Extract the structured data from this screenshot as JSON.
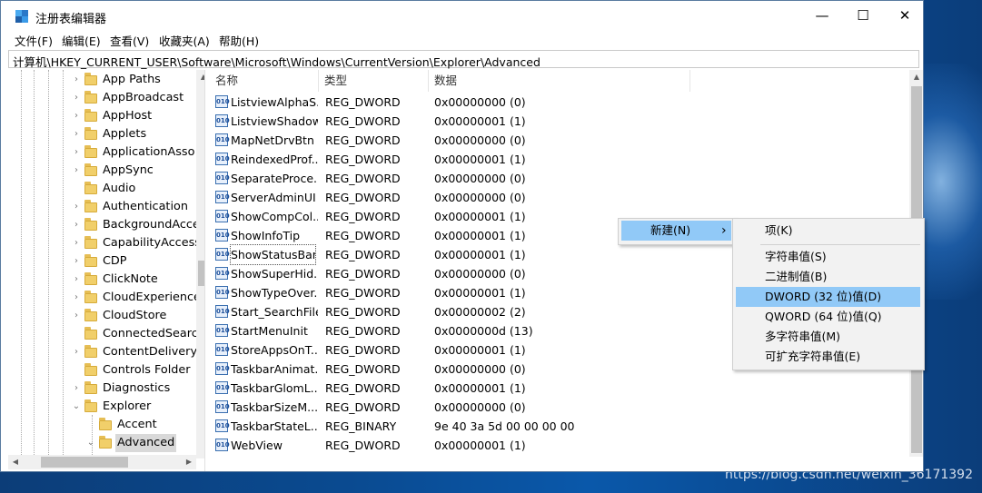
{
  "window": {
    "title": "注册表编辑器",
    "controls": {
      "minimize": "—",
      "maximize": "☐",
      "close": "✕"
    }
  },
  "menu": [
    "文件(F)",
    "编辑(E)",
    "查看(V)",
    "收藏夹(A)",
    "帮助(H)"
  ],
  "address": "计算机\\HKEY_CURRENT_USER\\Software\\Microsoft\\Windows\\CurrentVersion\\Explorer\\Advanced",
  "tree": [
    {
      "label": "App Paths",
      "expander": "›"
    },
    {
      "label": "AppBroadcast",
      "expander": "›"
    },
    {
      "label": "AppHost",
      "expander": "›"
    },
    {
      "label": "Applets",
      "expander": "›"
    },
    {
      "label": "ApplicationAsso",
      "expander": "›"
    },
    {
      "label": "AppSync",
      "expander": "›"
    },
    {
      "label": "Audio",
      "expander": ""
    },
    {
      "label": "Authentication",
      "expander": "›"
    },
    {
      "label": "BackgroundAcce",
      "expander": "›"
    },
    {
      "label": "CapabilityAccess",
      "expander": "›"
    },
    {
      "label": "CDP",
      "expander": "›"
    },
    {
      "label": "ClickNote",
      "expander": "›"
    },
    {
      "label": "CloudExperience",
      "expander": "›"
    },
    {
      "label": "CloudStore",
      "expander": "›"
    },
    {
      "label": "ConnectedSearc",
      "expander": ""
    },
    {
      "label": "ContentDelivery",
      "expander": "›"
    },
    {
      "label": "Controls Folder",
      "expander": ""
    },
    {
      "label": "Diagnostics",
      "expander": "›"
    },
    {
      "label": "Explorer",
      "expander": "⌄"
    },
    {
      "label": "Accent",
      "expander": ""
    },
    {
      "label": "Advanced",
      "expander": "⌄"
    }
  ],
  "columns": {
    "name": "名称",
    "type": "类型",
    "data": "数据"
  },
  "rows": [
    {
      "name": "ListviewAlphaS...",
      "type": "REG_DWORD",
      "data": "0x00000000 (0)"
    },
    {
      "name": "ListviewShadow",
      "type": "REG_DWORD",
      "data": "0x00000001 (1)"
    },
    {
      "name": "MapNetDrvBtn",
      "type": "REG_DWORD",
      "data": "0x00000000 (0)"
    },
    {
      "name": "ReindexedProf...",
      "type": "REG_DWORD",
      "data": "0x00000001 (1)"
    },
    {
      "name": "SeparateProce...",
      "type": "REG_DWORD",
      "data": "0x00000000 (0)"
    },
    {
      "name": "ServerAdminUI",
      "type": "REG_DWORD",
      "data": "0x00000000 (0)"
    },
    {
      "name": "ShowCompCol...",
      "type": "REG_DWORD",
      "data": "0x00000001 (1)"
    },
    {
      "name": "ShowInfoTip",
      "type": "REG_DWORD",
      "data": "0x00000001 (1)"
    },
    {
      "name": "ShowStatusBar",
      "type": "REG_DWORD",
      "data": "0x00000001 (1)"
    },
    {
      "name": "ShowSuperHid...",
      "type": "REG_DWORD",
      "data": "0x00000000 (0)"
    },
    {
      "name": "ShowTypeOver...",
      "type": "REG_DWORD",
      "data": "0x00000001 (1)"
    },
    {
      "name": "Start_SearchFiles",
      "type": "REG_DWORD",
      "data": "0x00000002 (2)"
    },
    {
      "name": "StartMenuInit",
      "type": "REG_DWORD",
      "data": "0x0000000d (13)"
    },
    {
      "name": "StoreAppsOnT...",
      "type": "REG_DWORD",
      "data": "0x00000001 (1)"
    },
    {
      "name": "TaskbarAnimat...",
      "type": "REG_DWORD",
      "data": "0x00000000 (0)"
    },
    {
      "name": "TaskbarGlomL...",
      "type": "REG_DWORD",
      "data": "0x00000001 (1)"
    },
    {
      "name": "TaskbarSizeM...",
      "type": "REG_DWORD",
      "data": "0x00000000 (0)"
    },
    {
      "name": "TaskbarStateL...",
      "type": "REG_BINARY",
      "data": "9e 40 3a 5d 00 00 00 00"
    },
    {
      "name": "WebView",
      "type": "REG_DWORD",
      "data": "0x00000001 (1)"
    }
  ],
  "context_menu": {
    "new_label": "新建(N)",
    "new_arrow": "›",
    "submenu": [
      "项(K)",
      "字符串值(S)",
      "二进制值(B)",
      "DWORD (32 位)值(D)",
      "QWORD (64 位)值(Q)",
      "多字符串值(M)",
      "可扩充字符串值(E)"
    ]
  },
  "watermark": "https://blog.csdn.net/weixin_36171392",
  "colors": {
    "highlight": "#91c9f7",
    "desktop": "#0a4a90"
  }
}
